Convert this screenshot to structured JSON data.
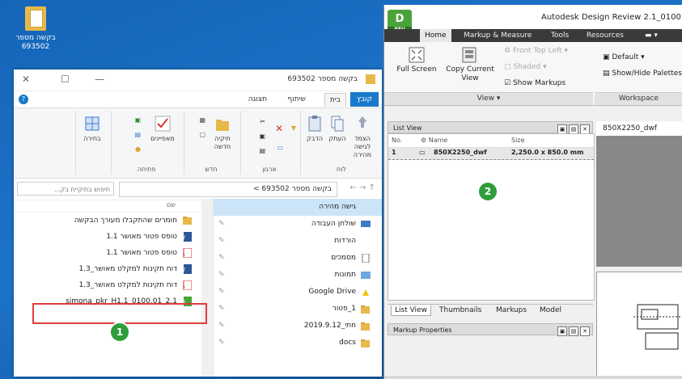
{
  "desktop": {
    "icon_label": "בקשה מספר 693502"
  },
  "explorer": {
    "title": "בקשה מספר 693502",
    "tabs": {
      "file": "קובץ",
      "home": "בית",
      "share": "שיתוף",
      "view": "תצוגה"
    },
    "ribbon": {
      "pin": "הצמד לגישה מהירה",
      "copy": "העתק",
      "paste": "הדבק",
      "new_folder": "תיקיה חדשה",
      "properties": "מאפיינים",
      "select": "בחירה",
      "groups": {
        "clipboard": "לוח",
        "organize": "ארגון",
        "new": "חדש",
        "open": "פתיחה"
      }
    },
    "address": "בקשה מספר 693502",
    "address_sep": ">",
    "search_placeholder": "חיפוש בתיקיית בק...",
    "column_name": "שם",
    "files": [
      {
        "name": "חומרים שהתקבלו מעורך הבקשה",
        "icon": "folder"
      },
      {
        "name": "טופס פטור מאושר 1.1",
        "icon": "word"
      },
      {
        "name": "טופס פטור מאושר 1.1",
        "icon": "pdf"
      },
      {
        "name": "דוח תקינות למקלט מאושר_1.3",
        "icon": "word"
      },
      {
        "name": "דוח תקינות למקלט מאושר_1.3",
        "icon": "pdf"
      },
      {
        "name": "2.1_0100.01_simona_pkr_H1.1",
        "icon": "dwf"
      }
    ],
    "nav": [
      {
        "name": "גישה מהירה",
        "icon": "star"
      },
      {
        "name": "שולחן העבודה",
        "icon": "desktop"
      },
      {
        "name": "הורדות",
        "icon": "download"
      },
      {
        "name": "מסמכים",
        "icon": "docs"
      },
      {
        "name": "תמונות",
        "icon": "pictures"
      },
      {
        "name": "Google Drive",
        "icon": "gdrive"
      },
      {
        "name": "1_פטור",
        "icon": "folder"
      },
      {
        "name": "חתי_2019.9.12",
        "icon": "folder"
      },
      {
        "name": "docs",
        "icon": "folder"
      }
    ]
  },
  "badges": {
    "one": "1",
    "two": "2"
  },
  "design_review": {
    "title": "Autodesk Design Review 2.1_0100",
    "logo": "D",
    "logo_sub": "REV",
    "menu": {
      "home": "Home",
      "markup": "Markup & Measure",
      "tools": "Tools",
      "resources": "Resources"
    },
    "ribbon": {
      "full_screen": "Full Screen",
      "copy_current_view": "Copy Current View",
      "front_top_left": "Front Top Left",
      "shaded": "Shaded",
      "show_markups": "Show Markups",
      "default": "Default",
      "show_hide_palettes": "Show/Hide Palettes",
      "group_view": "View",
      "group_workspace": "Workspace"
    },
    "list_view": {
      "header": "List View",
      "col_no": "No.",
      "col_name": "Name",
      "col_size": "Size",
      "row": {
        "no": "1",
        "name": "850X2250_dwf",
        "size": "2,250.0 x 850.0 mm"
      }
    },
    "tabs": [
      "List View",
      "Thumbnails",
      "Markups",
      "Model"
    ],
    "markup_properties": "Markup Properties",
    "view_tab": "850X2250_dwf"
  }
}
